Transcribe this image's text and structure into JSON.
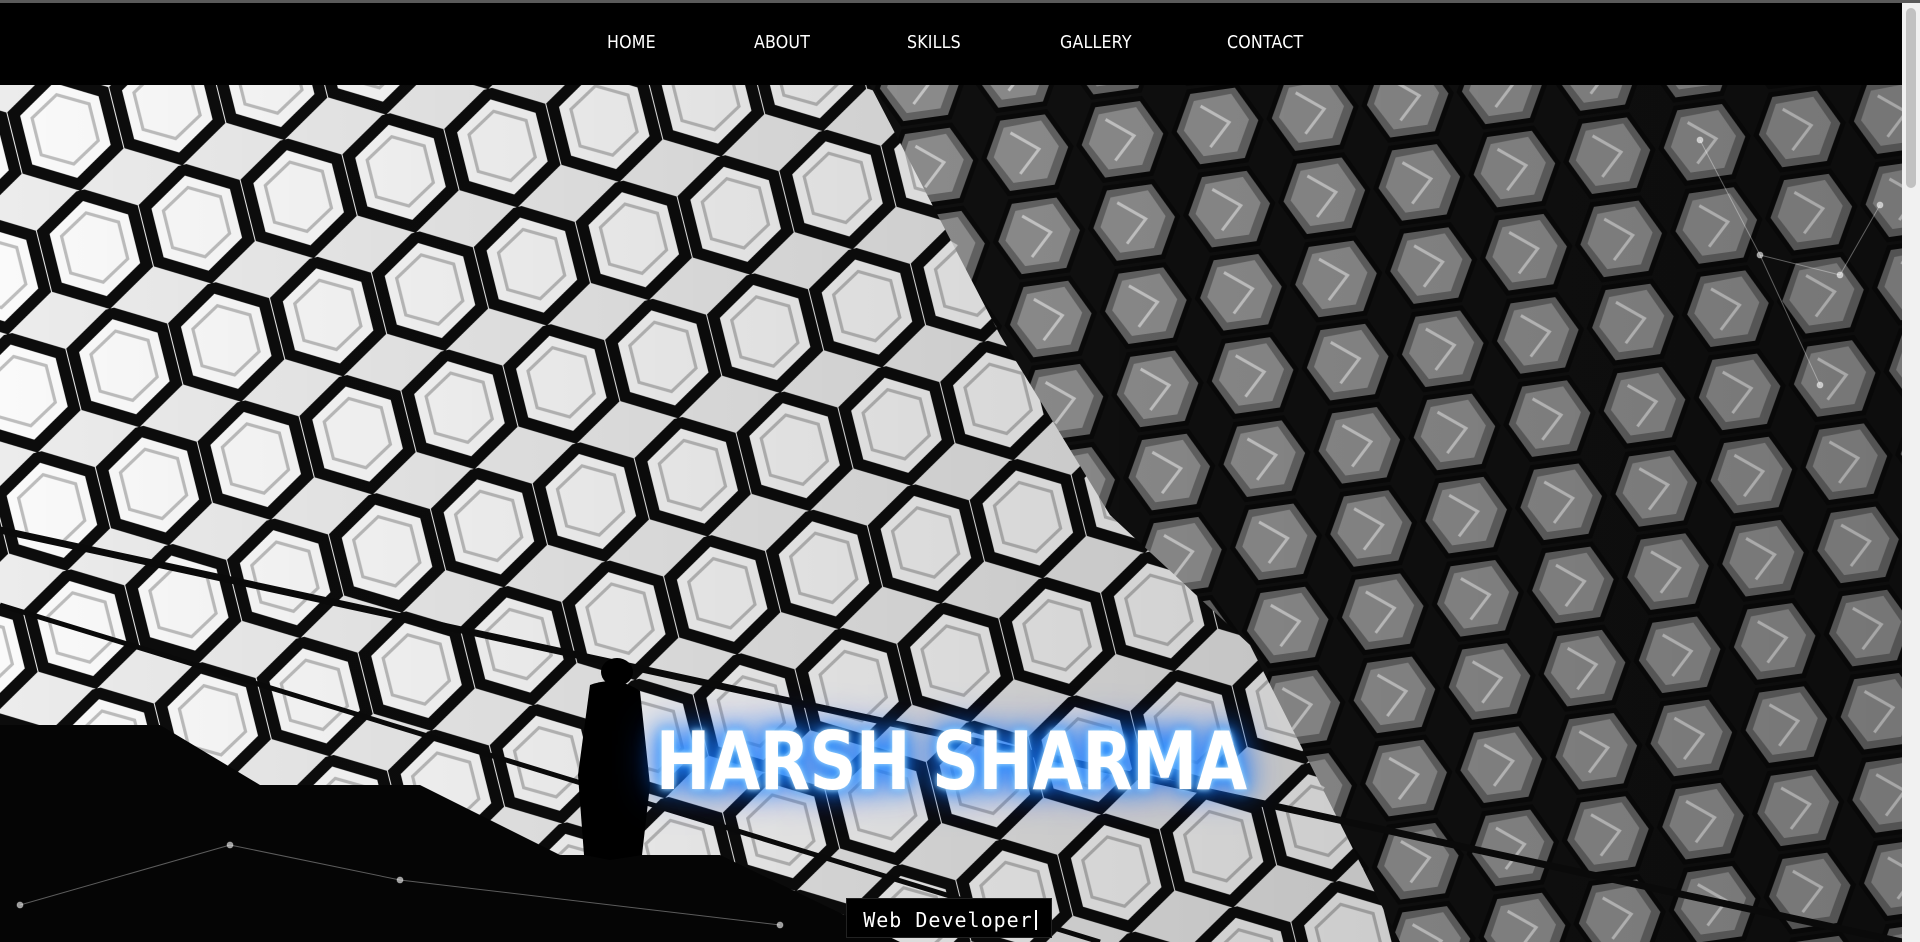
{
  "nav": {
    "items": [
      {
        "label": "HOME"
      },
      {
        "label": "ABOUT"
      },
      {
        "label": "SKILLS"
      },
      {
        "label": "GALLERY"
      },
      {
        "label": "CONTACT"
      }
    ]
  },
  "hero": {
    "title": "HARSH SHARMA",
    "subtitle": "Web Developer",
    "background": "grayscale hexagonal glass facade with silhouetted figure on staircase"
  },
  "colors": {
    "nav_background": "#000000",
    "nav_text": "#ffffff",
    "title_glow": "#1576ff",
    "scrollbar_track": "#f1f1f1",
    "scrollbar_thumb": "#c1c1c1"
  }
}
